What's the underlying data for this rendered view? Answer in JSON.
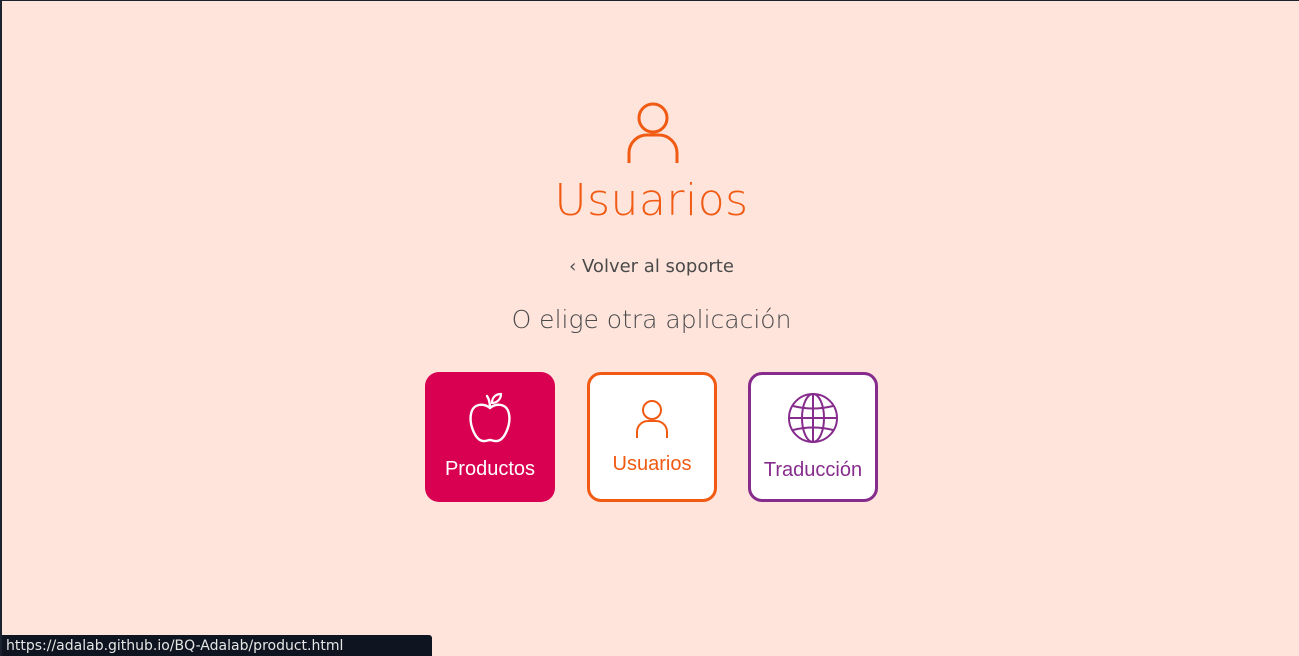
{
  "header": {
    "icon": "user-icon",
    "title": "Usuarios",
    "accent_color": "#f05a12"
  },
  "back_link": {
    "label": "‹ Volver al soporte"
  },
  "chooser": {
    "prompt": "O elige otra aplicación",
    "apps": [
      {
        "label": "Productos",
        "icon": "apple-icon",
        "color": "#d90052",
        "state": "filled"
      },
      {
        "label": "Usuarios",
        "icon": "user-icon",
        "color": "#f05a12",
        "state": "outlined"
      },
      {
        "label": "Traducción",
        "icon": "globe-icon",
        "color": "#862c8c",
        "state": "outlined"
      }
    ]
  },
  "status_bar": {
    "url": "https://adalab.github.io/BQ-Adalab/product.html"
  },
  "background_color": "#ffe4dc"
}
